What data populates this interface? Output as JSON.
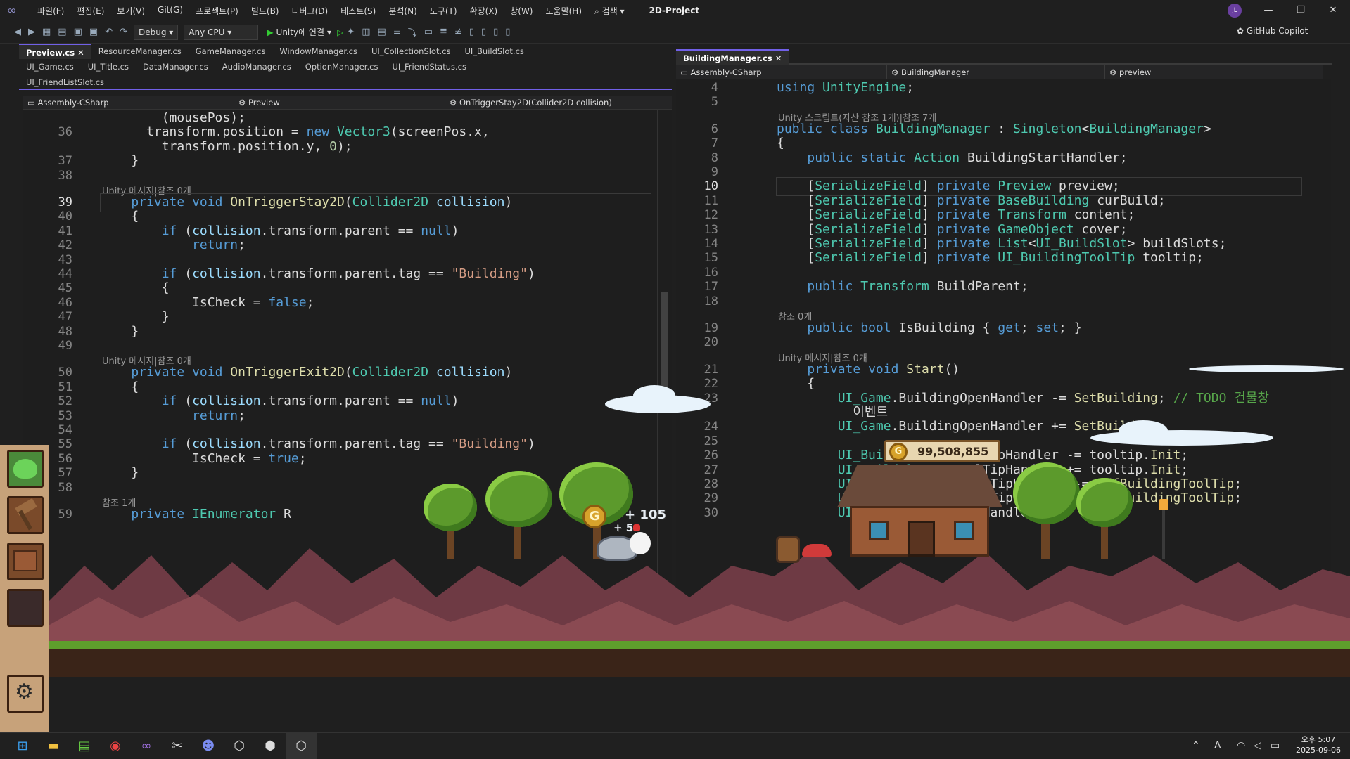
{
  "menubar": {
    "items": [
      "파일(F)",
      "편집(E)",
      "보기(V)",
      "Git(G)",
      "프로젝트(P)",
      "빌드(B)",
      "디버그(D)",
      "테스트(S)",
      "분석(N)",
      "도구(T)",
      "확장(X)",
      "창(W)",
      "도움말(H)"
    ],
    "search": "검색",
    "project_title": "2D-Project",
    "avatar": "JL"
  },
  "toolbar": {
    "config": "Debug",
    "platform": "Any CPU",
    "run_label": "Unity에 연결",
    "copilot": "GitHub Copilot"
  },
  "left_pane": {
    "tabs_row1": [
      "Preview.cs",
      "ResourceManager.cs",
      "GameManager.cs",
      "WindowManager.cs",
      "UI_CollectionSlot.cs",
      "UI_BuildSlot.cs"
    ],
    "tabs_row2": [
      "UI_Game.cs",
      "UI_Title.cs",
      "DataManager.cs",
      "AudioManager.cs",
      "OptionManager.cs",
      "UI_FriendStatus.cs"
    ],
    "tabs_row3": [
      "UI_FriendListSlot.cs"
    ],
    "nav": {
      "project": "Assembly-CSharp",
      "class": "Preview",
      "member": "OnTriggerStay2D(Collider2D collision)"
    },
    "lines": [
      {
        "n": "",
        "code": "        (mousePos);"
      },
      {
        "n": "36",
        "code": "      transform.position = new Vector3(screenPos.x,"
      },
      {
        "n": "",
        "code": "        transform.position.y, 0);"
      },
      {
        "n": "37",
        "code": "    }"
      },
      {
        "n": "38",
        "code": ""
      },
      {
        "lens": "Unity 메시지|참조 0개"
      },
      {
        "n": "39",
        "code": "    private void OnTriggerStay2D(Collider2D collision)",
        "current": true
      },
      {
        "n": "40",
        "code": "    {"
      },
      {
        "n": "41",
        "code": "        if (collision.transform.parent == null)"
      },
      {
        "n": "42",
        "code": "            return;"
      },
      {
        "n": "43",
        "code": ""
      },
      {
        "n": "44",
        "code": "        if (collision.transform.parent.tag == \"Building\")"
      },
      {
        "n": "45",
        "code": "        {"
      },
      {
        "n": "46",
        "code": "            IsCheck = false;"
      },
      {
        "n": "47",
        "code": "        }"
      },
      {
        "n": "48",
        "code": "    }"
      },
      {
        "n": "49",
        "code": ""
      },
      {
        "lens": "Unity 메시지|참조 0개"
      },
      {
        "n": "50",
        "code": "    private void OnTriggerExit2D(Collider2D collision)"
      },
      {
        "n": "51",
        "code": "    {"
      },
      {
        "n": "52",
        "code": "        if (collision.transform.parent == null)"
      },
      {
        "n": "53",
        "code": "            return;"
      },
      {
        "n": "54",
        "code": ""
      },
      {
        "n": "55",
        "code": "        if (collision.transform.parent.tag == \"Building\")"
      },
      {
        "n": "56",
        "code": "            IsCheck = true;"
      },
      {
        "n": "57",
        "code": "    }"
      },
      {
        "n": "58",
        "code": ""
      },
      {
        "lens": "참조 1개"
      },
      {
        "n": "59",
        "code": "    private IEnumerator R"
      }
    ]
  },
  "right_pane": {
    "tab": "BuildingManager.cs",
    "nav": {
      "project": "Assembly-CSharp",
      "class": "BuildingManager",
      "member": "preview"
    },
    "lines": [
      {
        "n": "4",
        "code": "using UnityEngine;"
      },
      {
        "n": "5",
        "code": ""
      },
      {
        "lens": "Unity 스크립트(자산 참조 1개)|참조 7개"
      },
      {
        "n": "6",
        "code": "public class BuildingManager : Singleton<BuildingManager>"
      },
      {
        "n": "7",
        "code": "{"
      },
      {
        "n": "8",
        "code": "    public static Action BuildingStartHandler;"
      },
      {
        "n": "9",
        "code": ""
      },
      {
        "n": "10",
        "code": "    [SerializeField] private Preview preview;",
        "current": true
      },
      {
        "n": "11",
        "code": "    [SerializeField] private BaseBuilding curBuild;"
      },
      {
        "n": "12",
        "code": "    [SerializeField] private Transform content;"
      },
      {
        "n": "13",
        "code": "    [SerializeField] private GameObject cover;"
      },
      {
        "n": "14",
        "code": "    [SerializeField] private List<UI_BuildSlot> buildSlots;"
      },
      {
        "n": "15",
        "code": "    [SerializeField] private UI_BuildingToolTip tooltip;"
      },
      {
        "n": "16",
        "code": ""
      },
      {
        "n": "17",
        "code": "    public Transform BuildParent;"
      },
      {
        "n": "18",
        "code": ""
      },
      {
        "lens": "참조 0개"
      },
      {
        "n": "19",
        "code": "    public bool IsBuilding { get; set; }"
      },
      {
        "n": "20",
        "code": ""
      },
      {
        "lens": "Unity 메시지|참조 0개"
      },
      {
        "n": "21",
        "code": "    private void Start()"
      },
      {
        "n": "22",
        "code": "    {"
      },
      {
        "n": "23",
        "code": "        UI_Game.BuildingOpenHandler -= SetBuilding; // TODO 건물창"
      },
      {
        "n": "",
        "code": "          이벤트"
      },
      {
        "n": "24",
        "code": "        UI_Game.BuildingOpenHandler += SetBuilding;"
      },
      {
        "n": "25",
        "code": ""
      },
      {
        "n": "26",
        "code": "        UI_BuildSlot.OnToolTipHandler -= tooltip.Init;"
      },
      {
        "n": "27",
        "code": "        UI_BuildSlot.OnToolTipHandler += tooltip.Init;"
      },
      {
        "n": "28",
        "code": "        UI_BuildSlot.OffToolTipHandler -= OffBuildingToolTip;"
      },
      {
        "n": "29",
        "code": "        UI_BuildSlot.OffToolTipHandler += OffBuildingToolTip;"
      },
      {
        "n": "30",
        "code": "        UI_BuildSlot.OnModeHandler -= "
      }
    ]
  },
  "game": {
    "gold_amount": "99,508,855",
    "coin_symbol": "G",
    "gain_popup_1": "+ 105",
    "gain_popup_2": "+ 5"
  },
  "taskbar": {
    "time": "오후 5:07",
    "date": "2025-09-06",
    "ime": "A"
  },
  "colors": {
    "accent": "#7160e8",
    "keyword": "#569cd6",
    "type": "#4ec9b0",
    "method": "#dcdcaa",
    "string": "#d69d85",
    "mountain": "#6e3a44",
    "grass": "#5e9f2c"
  }
}
